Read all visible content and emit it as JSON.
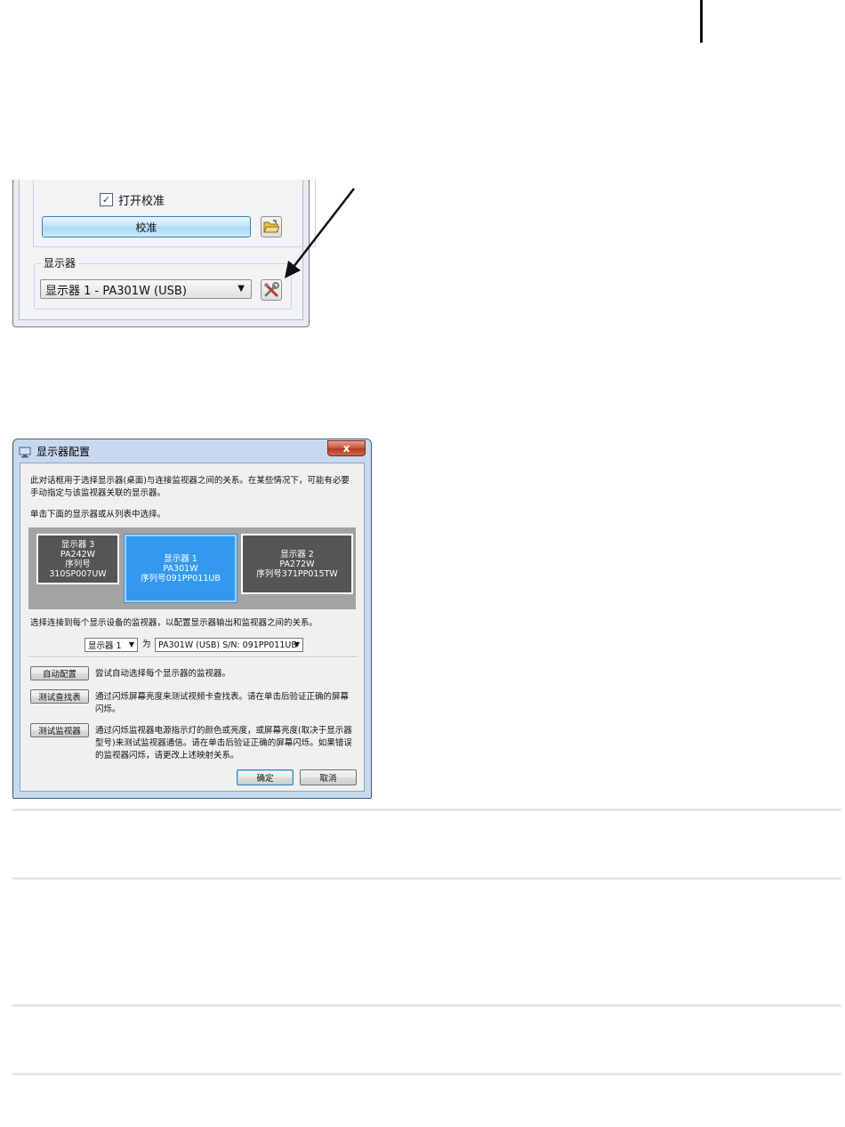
{
  "calibration_panel": {
    "open_calibration_label": "打开校准",
    "open_calibration_checked": true,
    "calibrate_button": "校准",
    "monitor_group_label": "显示器",
    "monitor_select_value": "显示器 1 - PA301W (USB)"
  },
  "dialog": {
    "title": "显示器配置",
    "close_label": "x",
    "intro_line1": "此对话框用于选择显示器(桌面)与连接监视器之间的关系。在某些情况下，可能有必要",
    "intro_line2": "手动指定与该监视器关联的显示器。",
    "click_hint": "单击下面的显示器或从列表中选择。",
    "monitors": [
      {
        "name": "显示器 3",
        "model": "PA242W",
        "serial": "序列号310SP007UW"
      },
      {
        "name": "显示器 1",
        "model": "PA301W",
        "serial": "序列号091PP011UB"
      },
      {
        "name": "显示器 2",
        "model": "PA272W",
        "serial": "序列号371PP015TW"
      }
    ],
    "select_instruction": "选择连接到每个显示设备的监视器，以配置显示器输出和监视器之间的关系。",
    "display_select": "显示器 1",
    "as_label": "为",
    "monitor_select": "PA301W (USB) S/N: 091PP011UB",
    "auto_config_button": "自动配置",
    "auto_config_desc": "尝试自动选择每个显示器的监视器。",
    "test_lookup_button": "测试查找表",
    "test_lookup_desc_1": "通过闪烁屏幕亮度来测试视频卡查找表。请在单击后验证正确的屏幕",
    "test_lookup_desc_2": "闪烁。",
    "test_monitor_button": "测试监视器",
    "test_monitor_desc_1": "通过闪烁监视器电源指示灯的颜色或亮度，或屏幕亮度(取决于显示器",
    "test_monitor_desc_2": "型号)来测试监视器通信。请在单击后验证正确的屏幕闪烁。如果错误",
    "test_monitor_desc_3": "的监视器闪烁，请更改上述映射关系。",
    "ok_button": "确定",
    "cancel_button": "取消"
  }
}
